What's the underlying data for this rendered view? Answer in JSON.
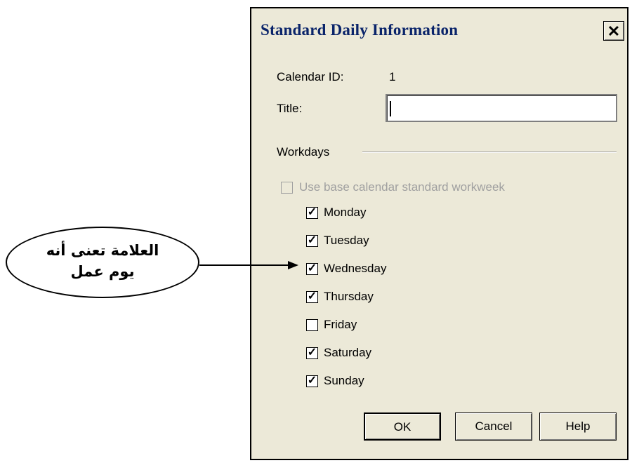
{
  "dialog": {
    "title": "Standard Daily Information",
    "close_glyph": "✕",
    "calendar_id_label": "Calendar ID:",
    "calendar_id_value": "1",
    "title_label": "Title:",
    "title_value": "",
    "workdays_label": "Workdays",
    "use_base_label": "Use base calendar standard workweek",
    "use_base_checked": false,
    "days": [
      {
        "label": "Monday",
        "checked": true
      },
      {
        "label": "Tuesday",
        "checked": true
      },
      {
        "label": "Wednesday",
        "checked": true
      },
      {
        "label": "Thursday",
        "checked": true
      },
      {
        "label": "Friday",
        "checked": false
      },
      {
        "label": "Saturday",
        "checked": true
      },
      {
        "label": "Sunday",
        "checked": true
      }
    ],
    "buttons": {
      "ok": "OK",
      "cancel": "Cancel",
      "help": "Help"
    }
  },
  "callout": {
    "line1": "العلامة تعنى أنه",
    "line2": "يوم عمل"
  },
  "colors": {
    "title_text": "#0a246a",
    "dialog_bg": "#ece9d8"
  }
}
